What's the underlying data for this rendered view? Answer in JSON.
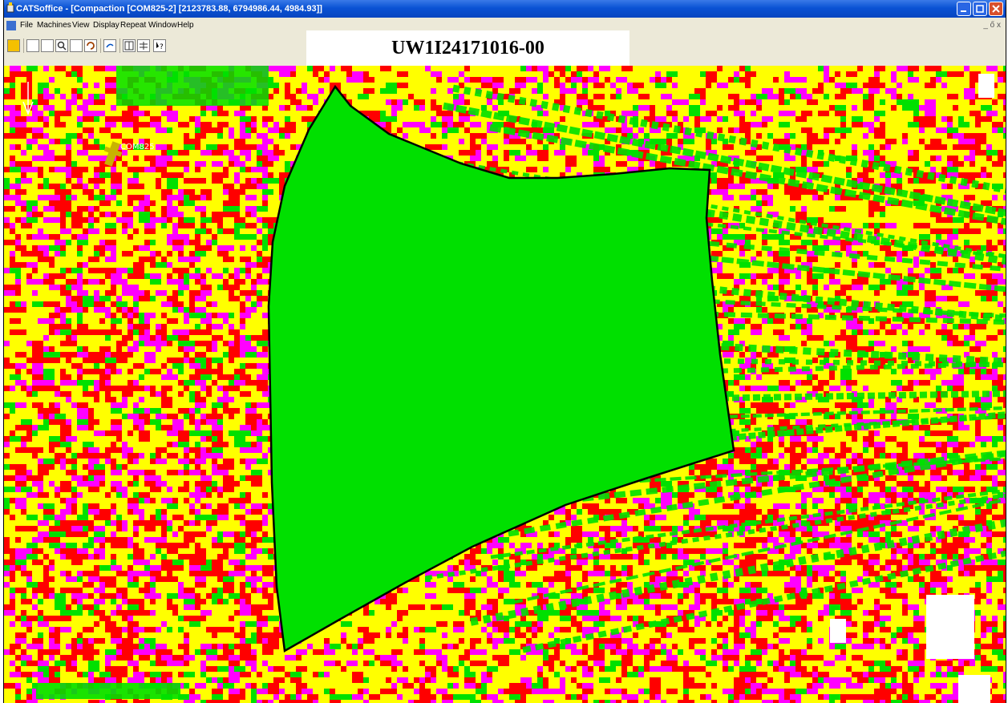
{
  "window": {
    "title": "CATSoffice - [Compaction [COM825-2] [2123783.88, 6794986.44, 4984.93]]"
  },
  "menu": {
    "items": [
      "File",
      "Machines",
      "View",
      "Display",
      "Repeat",
      "Window",
      "Help"
    ],
    "mdi_controls": "_ ő x"
  },
  "toolbar": {
    "icons": [
      "save-icon",
      "new-doc-icon",
      "open-icon",
      "zoom-icon",
      "pan-icon",
      "undo-icon",
      "redo-icon",
      "split-view-icon",
      "grid-icon",
      "help-pointer-icon"
    ]
  },
  "overlay": {
    "code": "UW1I24171016-00"
  },
  "map": {
    "base_color": "#ffff00",
    "colors": {
      "compacted": "#00e000",
      "partial": "#ff00ff",
      "uncompacted": "#ff0000",
      "nodata": "#ffffff",
      "boundary": "#000000"
    },
    "machine_label": "COM825"
  }
}
